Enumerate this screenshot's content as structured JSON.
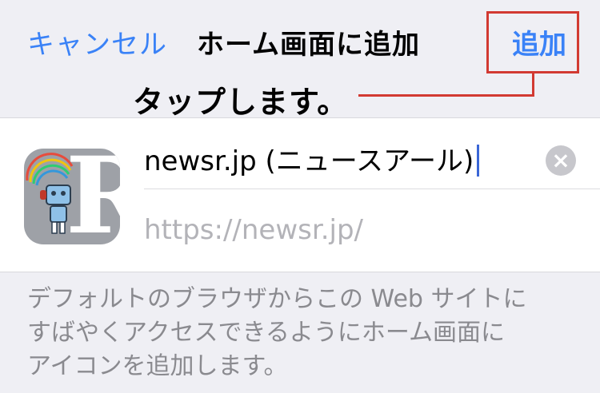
{
  "navbar": {
    "cancel_label": "キャンセル",
    "title": "ホーム画面に追加",
    "add_label": "追加"
  },
  "annotation": {
    "text": "タップします。"
  },
  "shortcut": {
    "icon_name": "newsr-app-icon",
    "icon_letter": "R",
    "title_value": "newsr.jp (ニュースアール)",
    "clear_icon": "×",
    "url": "https://newsr.jp/"
  },
  "description": {
    "lines": [
      "デフォルトのブラウザからこの Web サイトに",
      "すばやくアクセスできるようにホーム画面に",
      "アイコンを追加します。"
    ]
  },
  "colors": {
    "accent": "#3a82f7",
    "annotation_red": "#d23a32",
    "background": "#efeff4"
  }
}
